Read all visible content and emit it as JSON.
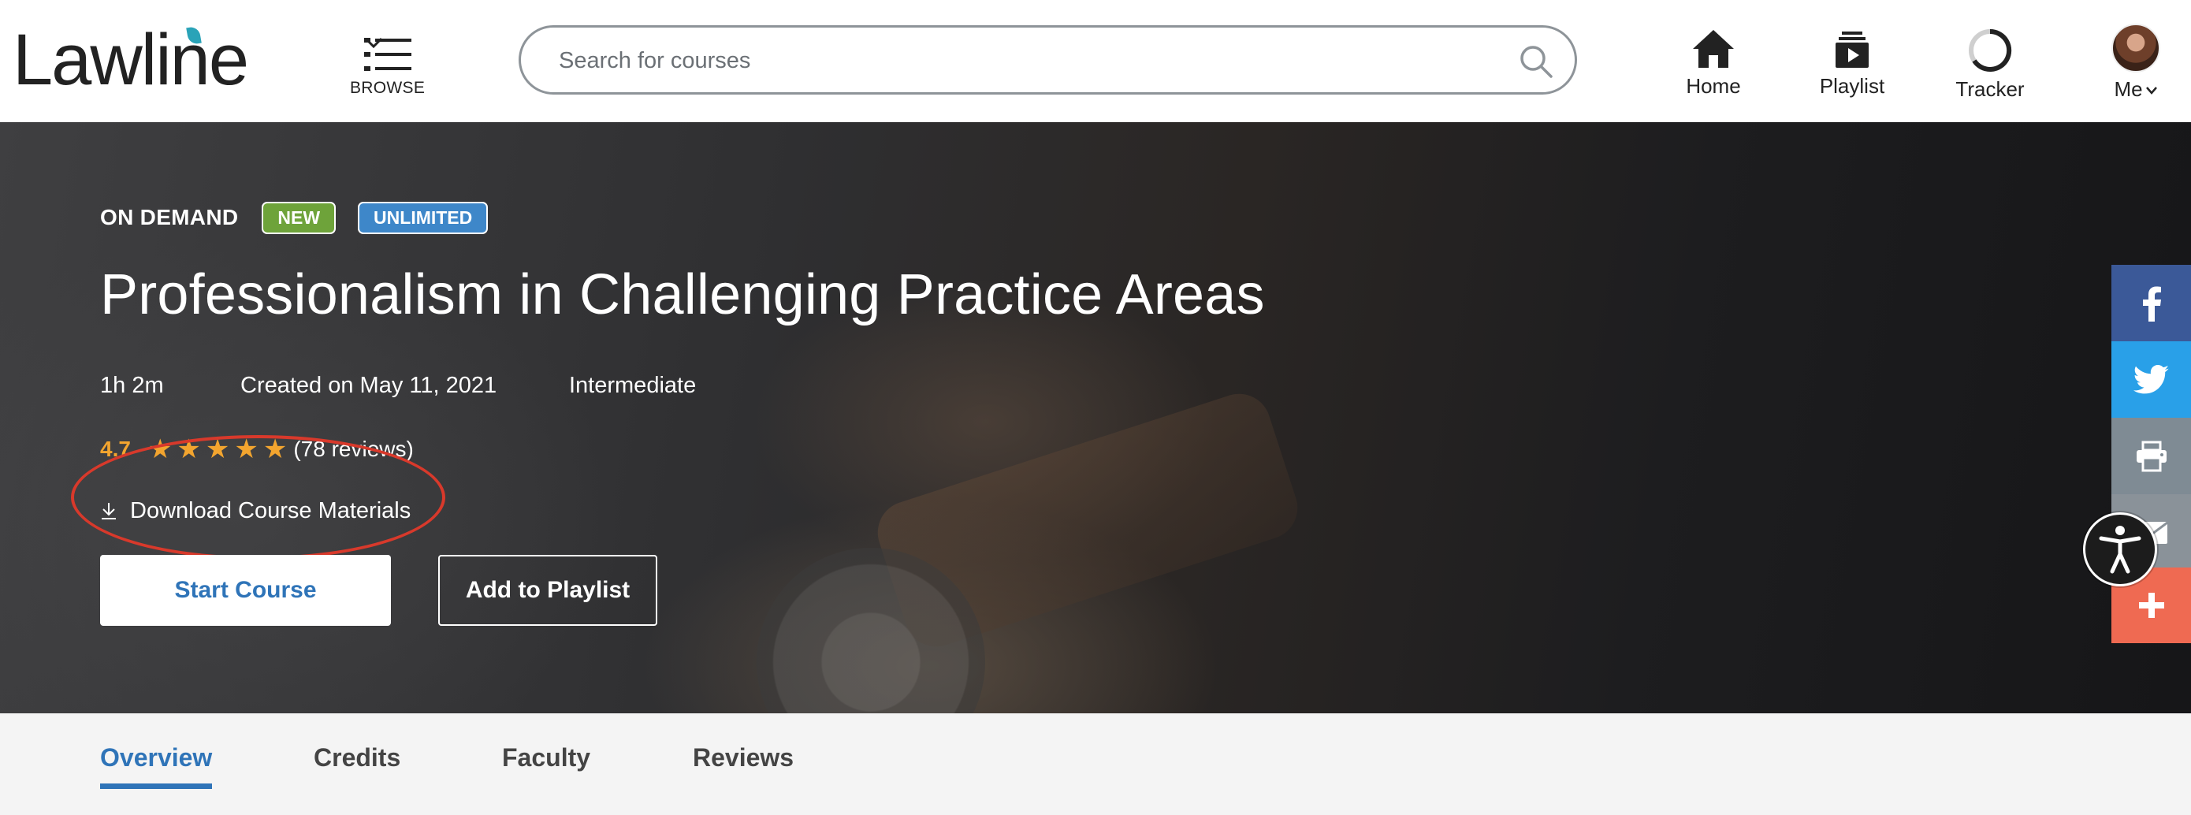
{
  "header": {
    "logo_text": "Lawline",
    "browse_label": "BROWSE",
    "search_placeholder": "Search for courses",
    "nav": [
      {
        "label": "Home",
        "icon": "home-icon"
      },
      {
        "label": "Playlist",
        "icon": "playlist-icon"
      },
      {
        "label": "Tracker",
        "icon": "tracker-icon"
      },
      {
        "label": "Me",
        "icon": "avatar"
      }
    ]
  },
  "course": {
    "format": "ON DEMAND",
    "badges": [
      "NEW",
      "UNLIMITED"
    ],
    "title": "Professionalism in Challenging Practice Areas",
    "duration": "1h 2m",
    "created": "Created on May 11, 2021",
    "level": "Intermediate",
    "rating": "4.7",
    "rating_stars": 5,
    "reviews": "(78 reviews)",
    "download_label": "Download Course Materials",
    "start_label": "Start Course",
    "playlist_label": "Add to Playlist"
  },
  "share": {
    "items": [
      "facebook-icon",
      "twitter-icon",
      "print-icon",
      "email-icon",
      "plus-icon"
    ]
  },
  "tabs": [
    {
      "label": "Overview",
      "active": true
    },
    {
      "label": "Credits",
      "active": false
    },
    {
      "label": "Faculty",
      "active": false
    },
    {
      "label": "Reviews",
      "active": false
    }
  ],
  "colors": {
    "brand_blue": "#2f74b8",
    "rating_orange": "#f3a52f",
    "badge_new": "#6ea33a",
    "badge_unlimited": "#3e87c9",
    "annotation_red": "#d8392b"
  }
}
